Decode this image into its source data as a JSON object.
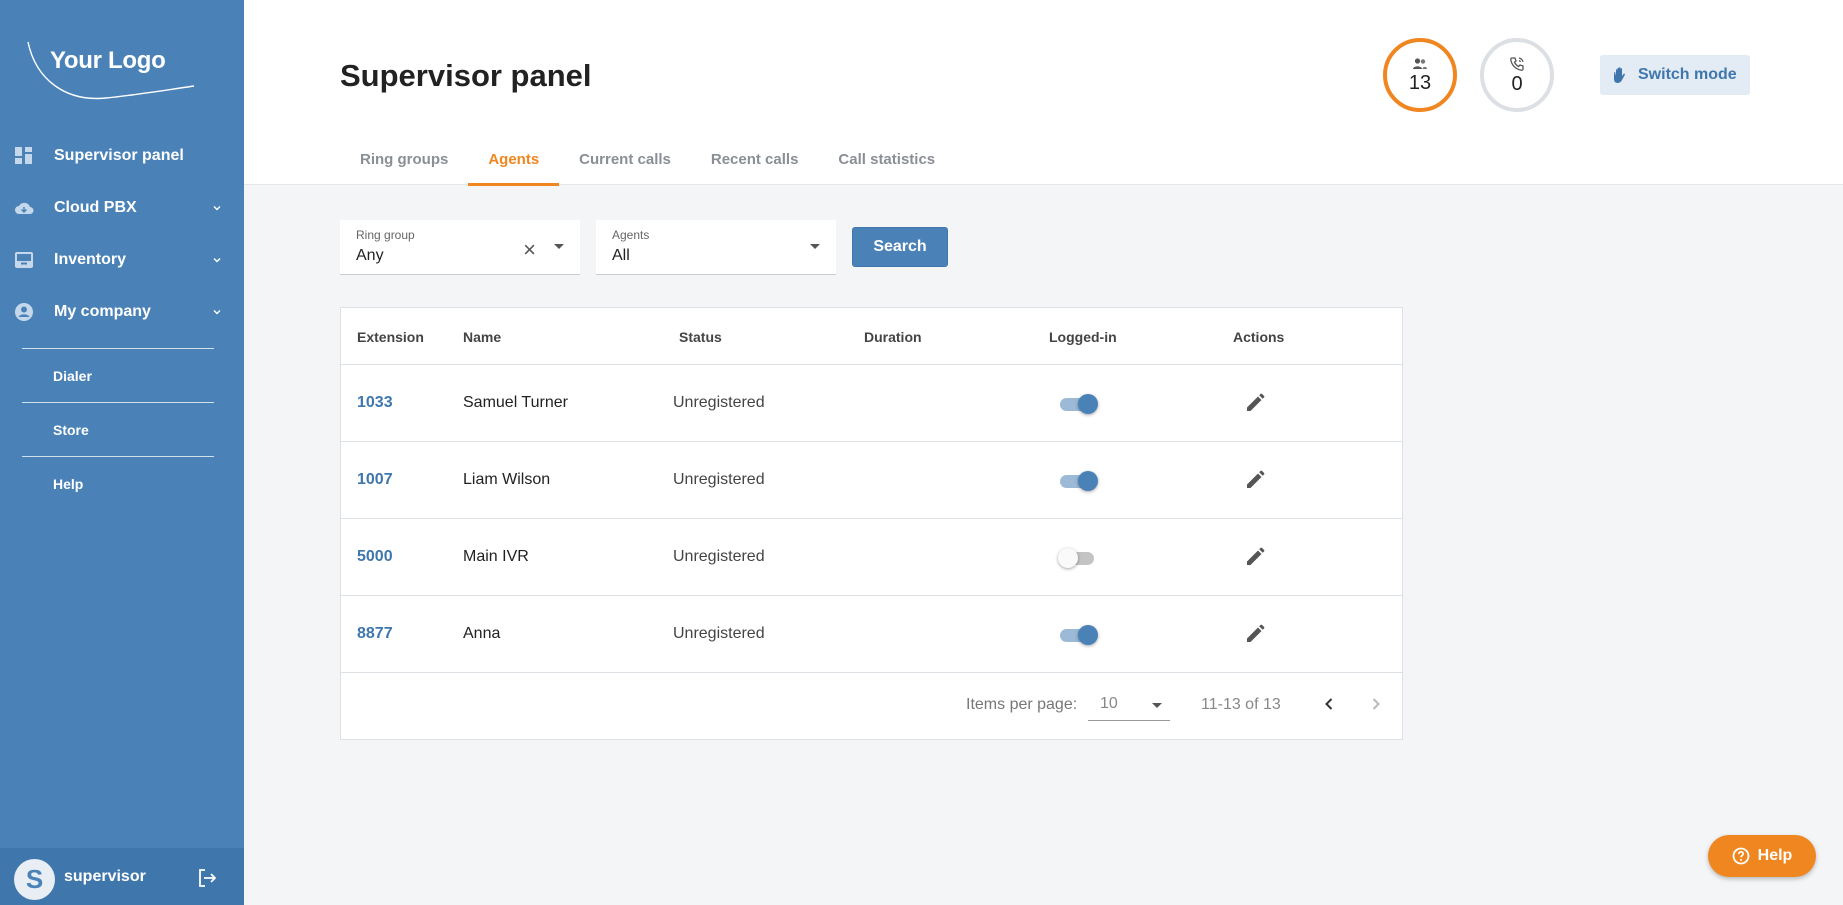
{
  "brand": {
    "logo_text": "Your Logo"
  },
  "sidebar": {
    "items": [
      {
        "label": "Supervisor panel",
        "icon": "dashboard-icon"
      },
      {
        "label": "Cloud PBX",
        "icon": "cloud-icon"
      },
      {
        "label": "Inventory",
        "icon": "inventory-icon"
      },
      {
        "label": "My company",
        "icon": "account-circle-icon"
      }
    ],
    "links": [
      {
        "label": "Dialer"
      },
      {
        "label": "Store"
      },
      {
        "label": "Help"
      }
    ],
    "user": {
      "initial": "S",
      "name": "supervisor"
    }
  },
  "header": {
    "title": "Supervisor panel",
    "tabs": [
      {
        "label": "Ring groups"
      },
      {
        "label": "Agents",
        "active": true
      },
      {
        "label": "Current calls"
      },
      {
        "label": "Recent calls"
      },
      {
        "label": "Call statistics"
      }
    ],
    "stats": {
      "agents_count": "13",
      "calls_count": "0"
    },
    "switch_mode_label": "Switch mode"
  },
  "filters": {
    "ring_group": {
      "label": "Ring group",
      "value": "Any"
    },
    "agents": {
      "label": "Agents",
      "value": "All"
    },
    "search_label": "Search"
  },
  "table": {
    "headers": [
      "Extension",
      "Name",
      "Status",
      "Duration",
      "Logged-in",
      "Actions"
    ],
    "rows": [
      {
        "extension": "1033",
        "name": "Samuel Turner",
        "status": "Unregistered",
        "duration": "",
        "logged_in": true
      },
      {
        "extension": "1007",
        "name": "Liam Wilson",
        "status": "Unregistered",
        "duration": "",
        "logged_in": true
      },
      {
        "extension": "5000",
        "name": "Main IVR",
        "status": "Unregistered",
        "duration": "",
        "logged_in": false
      },
      {
        "extension": "8877",
        "name": "Anna",
        "status": "Unregistered",
        "duration": "",
        "logged_in": true
      }
    ],
    "paginator": {
      "items_per_page_label": "Items per page:",
      "items_per_page": "10",
      "range": "11-13 of 13"
    }
  },
  "help_button_label": "Help",
  "colors": {
    "primary": "#4a82b8",
    "accent": "#f0861f",
    "sidebar_bg": "#4a82b8"
  }
}
